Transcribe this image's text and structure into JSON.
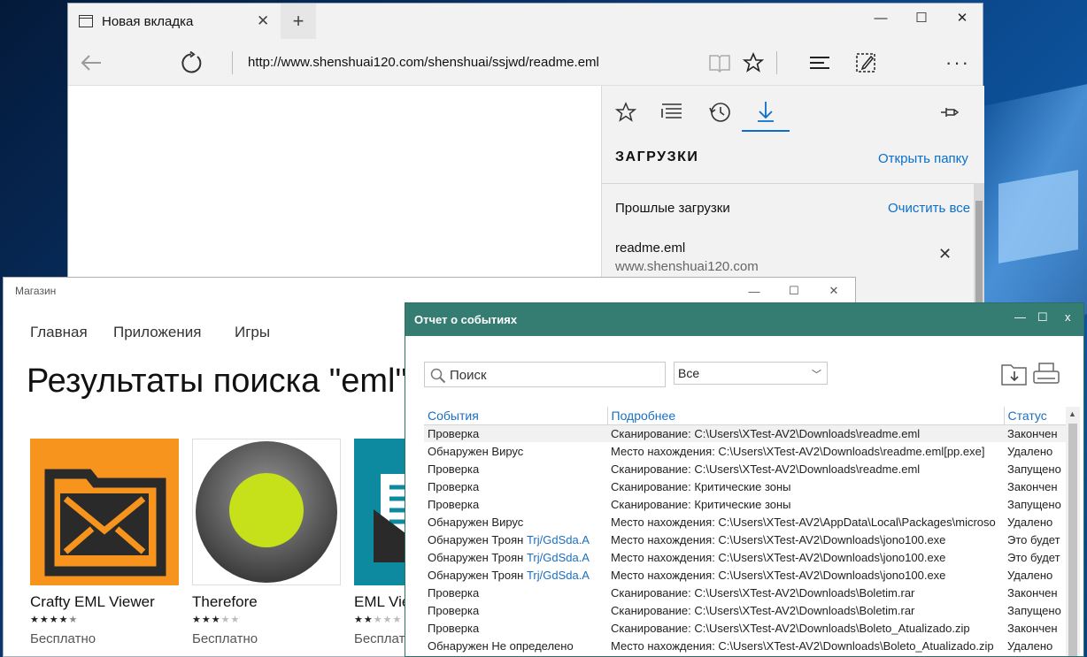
{
  "edge": {
    "tab_title": "Новая вкладка",
    "address": "http://www.shenshuai120.com/shenshuai/ssjwd/readme.eml",
    "hub": {
      "title": "ЗАГРУЗКИ",
      "open_folder": "Открыть папку",
      "past_downloads": "Прошлые загрузки",
      "clear_all": "Очистить все",
      "download_name": "readme.eml",
      "download_source": "www.shenshuai120.com"
    }
  },
  "store": {
    "app_title": "Магазин",
    "nav": [
      "Главная",
      "Приложения",
      "Игры"
    ],
    "results_title": "Результаты поиска \"eml\"",
    "apps": [
      {
        "name": "Crafty EML Viewer",
        "rating": 4.5,
        "price": "Бесплатно"
      },
      {
        "name": "Therefore",
        "rating": 3,
        "price": "Бесплатно"
      },
      {
        "name": "EML Vie",
        "rating": 2.5,
        "price": "Бесплатно"
      }
    ]
  },
  "events": {
    "title": "Отчет о событиях",
    "search_placeholder": "Поиск",
    "filter_value": "Все",
    "columns": [
      "События",
      "Подробнее",
      "Статус"
    ],
    "rows": [
      {
        "event": "Проверка",
        "threat": "",
        "details": "Сканирование: C:\\Users\\XTest-AV2\\Downloads\\readme.eml",
        "status": "Закончен"
      },
      {
        "event": "Обнаружен Вирус",
        "threat": "",
        "details": "Место нахождения: C:\\Users\\XTest-AV2\\Downloads\\readme.eml[pp.exe]",
        "status": "Удалено"
      },
      {
        "event": "Проверка",
        "threat": "",
        "details": "Сканирование: C:\\Users\\XTest-AV2\\Downloads\\readme.eml",
        "status": "Запущено"
      },
      {
        "event": "Проверка",
        "threat": "",
        "details": "Сканирование: Критические зоны",
        "status": "Закончен"
      },
      {
        "event": "Проверка",
        "threat": "",
        "details": "Сканирование: Критические зоны",
        "status": "Запущено"
      },
      {
        "event": "Обнаружен Вирус",
        "threat": "",
        "details": "Место нахождения: C:\\Users\\XTest-AV2\\AppData\\Local\\Packages\\microso",
        "status": "Удалено"
      },
      {
        "event": "Обнаружен Троян",
        "threat": "Trj/GdSda.A",
        "details": "Место нахождения: C:\\Users\\XTest-AV2\\Downloads\\jono100.exe",
        "status": "Это будет"
      },
      {
        "event": "Обнаружен Троян",
        "threat": "Trj/GdSda.A",
        "details": "Место нахождения: C:\\Users\\XTest-AV2\\Downloads\\jono100.exe",
        "status": "Это будет"
      },
      {
        "event": "Обнаружен Троян",
        "threat": "Trj/GdSda.A",
        "details": "Место нахождения: C:\\Users\\XTest-AV2\\Downloads\\jono100.exe",
        "status": "Удалено"
      },
      {
        "event": "Проверка",
        "threat": "",
        "details": "Сканирование: C:\\Users\\XTest-AV2\\Downloads\\Boletim.rar",
        "status": "Закончен"
      },
      {
        "event": "Проверка",
        "threat": "",
        "details": "Сканирование: C:\\Users\\XTest-AV2\\Downloads\\Boletim.rar",
        "status": "Запущено"
      },
      {
        "event": "Проверка",
        "threat": "",
        "details": "Сканирование: C:\\Users\\XTest-AV2\\Downloads\\Boleto_Atualizado.zip",
        "status": "Закончен"
      },
      {
        "event": "Обнаружен Не определено",
        "threat": "",
        "details": "Место нахождения: C:\\Users\\XTest-AV2\\Downloads\\Boleto_Atualizado.zip",
        "status": "Удалено"
      }
    ]
  },
  "colors": {
    "edge_accent": "#0b6fc9",
    "event_titlebar": "#357d72",
    "link_blue": "#1c6fc0",
    "crafty_orange": "#f7941d",
    "therefore_green": "#c6e01a",
    "eml_teal": "#0e8aa0"
  },
  "icons": [
    "new-tab-icon",
    "back-icon",
    "refresh-icon",
    "reading-view-icon",
    "favorite-star-icon",
    "hub-icon",
    "web-note-icon",
    "more-icon",
    "favorites-icon",
    "reading-list-icon",
    "history-icon",
    "downloads-icon",
    "pin-icon",
    "search-icon",
    "export-icon",
    "print-icon"
  ]
}
